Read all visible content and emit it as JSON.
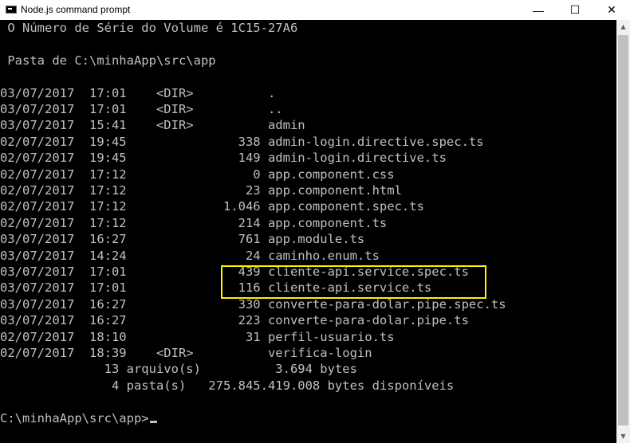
{
  "window": {
    "title": "Node.js command prompt",
    "minimize_glyph": "—",
    "maximize_glyph": "☐",
    "close_glyph": "✕"
  },
  "console": {
    "lines": [
      " O Número de Série do Volume é 1C15-27A6",
      "",
      " Pasta de C:\\minhaApp\\src\\app",
      "",
      "03/07/2017  17:01    <DIR>          .",
      "03/07/2017  17:01    <DIR>          ..",
      "03/07/2017  15:41    <DIR>          admin",
      "02/07/2017  19:45               338 admin-login.directive.spec.ts",
      "02/07/2017  19:45               149 admin-login.directive.ts",
      "02/07/2017  17:12                 0 app.component.css",
      "02/07/2017  17:12                23 app.component.html",
      "02/07/2017  17:12             1.046 app.component.spec.ts",
      "02/07/2017  17:12               214 app.component.ts",
      "03/07/2017  16:27               761 app.module.ts",
      "03/07/2017  14:24                24 caminho.enum.ts",
      "03/07/2017  17:01               439 cliente-api.service.spec.ts",
      "03/07/2017  17:01               116 cliente-api.service.ts",
      "03/07/2017  16:27               330 converte-para-dolar.pipe.spec.ts",
      "03/07/2017  16:27               223 converte-para-dolar.pipe.ts",
      "02/07/2017  18:10                31 perfil-usuario.ts",
      "02/07/2017  18:39    <DIR>          verifica-login",
      "              13 arquivo(s)          3.694 bytes",
      "               4 pasta(s)   275.845.419.008 bytes disponíveis",
      "",
      "C:\\minhaApp\\src\\app>"
    ]
  },
  "colors": {
    "background": "#000000",
    "text": "#c0c0c0",
    "highlight_border": "#fff200"
  },
  "icons": {
    "app": "console-icon",
    "scroll_up": "arrow-up-icon",
    "scroll_down": "arrow-down-icon"
  }
}
